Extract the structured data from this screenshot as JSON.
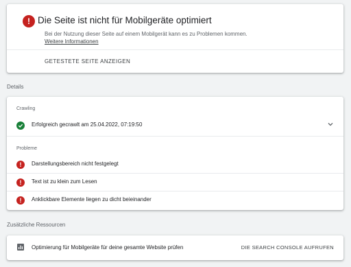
{
  "issue": {
    "title": "Die Seite ist nicht für Mobilgeräte optimiert",
    "description": "Bei der Nutzung dieser Seite auf einem Mobilgerät kann es zu Problemen kommen.",
    "link": "Weitere Informationen",
    "button": "GETESTETE SEITE ANZEIGEN",
    "icon": "error-icon"
  },
  "details": {
    "heading": "Details",
    "crawling": {
      "label": "Crawling",
      "status": "Erfolgreich gecrawlt am 25.04.2022, 07:19:50",
      "icon": "check-circle-icon"
    },
    "problems": {
      "label": "Probleme",
      "items": [
        {
          "text": "Darstellungsbereich nicht festgelegt",
          "icon": "error-icon"
        },
        {
          "text": "Text ist zu klein zum Lesen",
          "icon": "error-icon"
        },
        {
          "text": "Anklickbare Elemente liegen zu dicht beieinander",
          "icon": "error-icon"
        }
      ]
    }
  },
  "resources": {
    "heading": "Zusätzliche Ressourcen",
    "text": "Optimierung für Mobilgeräte für deine gesamte Website prüfen",
    "button": "DIE SEARCH CONSOLE AUFRUFEN",
    "icon": "bar-chart-icon"
  },
  "colors": {
    "error": "#c5221f",
    "success": "#188038",
    "background": "#f1f3f4"
  }
}
